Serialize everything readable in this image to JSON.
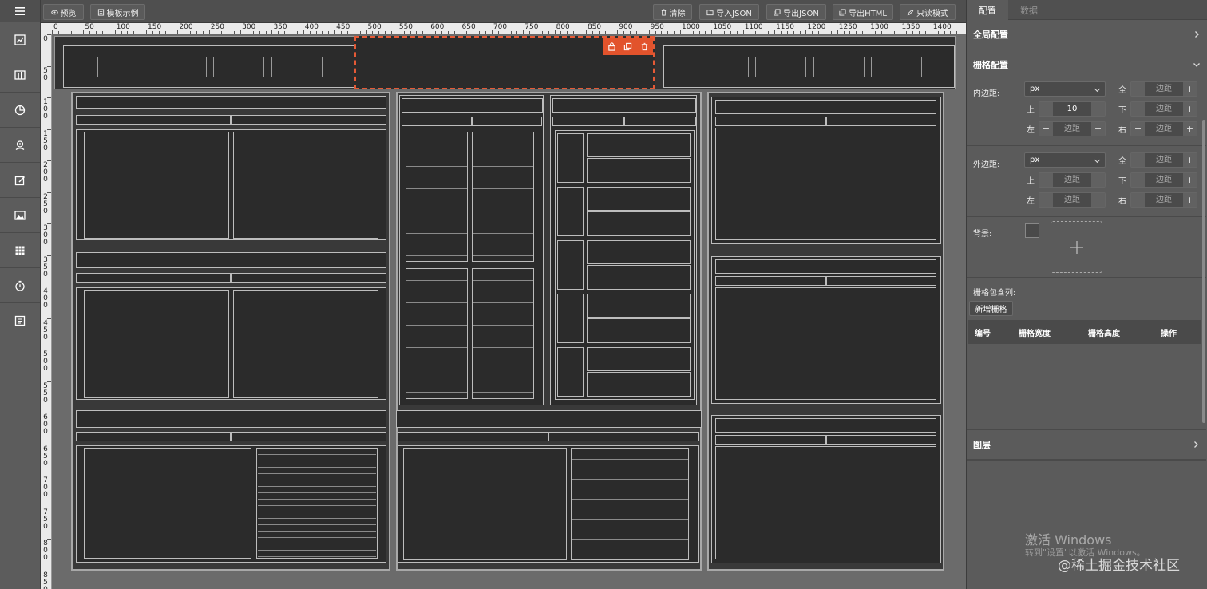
{
  "toolbar": {
    "preview": "预览",
    "template_example": "模板示例",
    "clear": "清除",
    "import_json": "导入JSON",
    "export_json": "导出JSON",
    "export_html": "导出HTML",
    "readonly_mode": "只读模式"
  },
  "sidebar": {
    "items": [
      {
        "icon": "line-chart-icon"
      },
      {
        "icon": "bar-chart-icon"
      },
      {
        "icon": "pie-chart-icon"
      },
      {
        "icon": "map-icon"
      },
      {
        "icon": "edit-icon"
      },
      {
        "icon": "image-icon"
      },
      {
        "icon": "grid-icon"
      },
      {
        "icon": "timer-icon"
      },
      {
        "icon": "table-icon"
      }
    ]
  },
  "ruler": {
    "top_labels": [
      "0",
      "50",
      "100",
      "150",
      "200",
      "250",
      "300",
      "350",
      "400",
      "450",
      "500",
      "550",
      "600",
      "650",
      "700",
      "750",
      "800",
      "850",
      "900",
      "950",
      "1000",
      "1050",
      "1100",
      "1150",
      "1200",
      "1250",
      "1300",
      "1350",
      "1400"
    ],
    "left_labels": [
      "0",
      "50",
      "100",
      "150",
      "200",
      "250",
      "300",
      "350",
      "400",
      "450",
      "500",
      "550",
      "600",
      "650",
      "700",
      "750",
      "800",
      "850"
    ]
  },
  "panel": {
    "tabs": [
      "配置",
      "数据"
    ],
    "global_config": "全局配置",
    "grid_config": "栅格配置",
    "padding_label": "内边距:",
    "margin_label": "外边距:",
    "unit_value": "px",
    "side_all": "全",
    "side_top": "上",
    "side_bottom": "下",
    "side_left": "左",
    "side_right": "右",
    "spacing_placeholder": "边距",
    "padding_top_value": "10",
    "background_label": "背景:",
    "grid_cols_label": "栅格包含列:",
    "add_grid_button": "新增栅格",
    "table_headers": [
      "编号",
      "栅格宽度",
      "栅格高度",
      "操作"
    ],
    "layers": "图层"
  },
  "watermark": {
    "line1": "激活 Windows",
    "line2": "转到\"设置\"以激活 Windows。",
    "credit": "@稀土掘金技术社区"
  },
  "colors": {
    "selection_accent": "#e2532c",
    "canvas_bg": "#6b6b6b",
    "panel_bg": "#5b5b5b"
  }
}
